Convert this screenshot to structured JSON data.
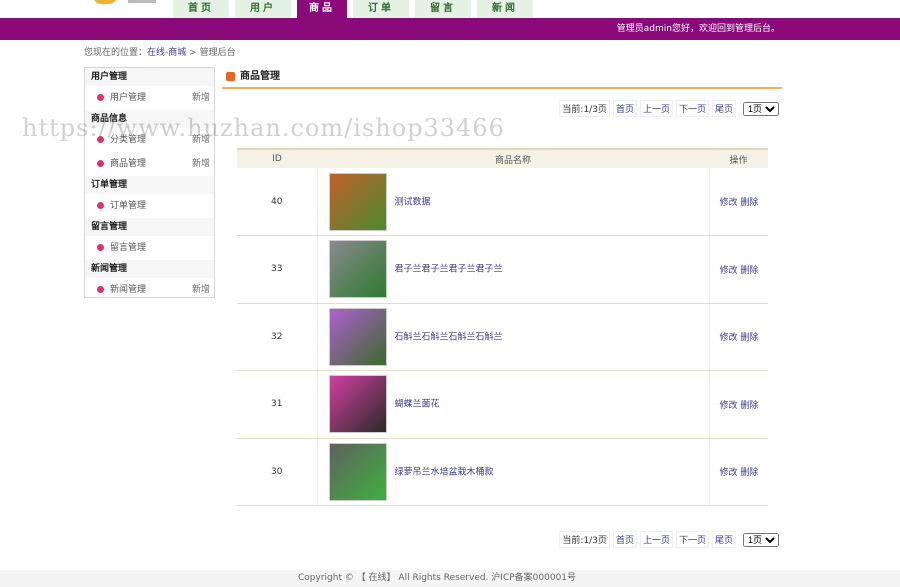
{
  "nav": {
    "tabs": [
      "首页",
      "用户",
      "商品",
      "订单",
      "留言",
      "新闻"
    ],
    "active": 2
  },
  "header": {
    "welcome": "管理员admin您好，欢迎回到管理后台。"
  },
  "breadcrumb": {
    "prefix": "您现在的位置：",
    "home": "在线-商城",
    "sep": ">",
    "current": "管理后台"
  },
  "sidebar": {
    "groups": [
      {
        "title": "用户管理",
        "items": [
          {
            "label": "用户管理",
            "add": "新增"
          }
        ]
      },
      {
        "title": "商品信息",
        "items": [
          {
            "label": "分类管理",
            "add": "新增"
          },
          {
            "label": "商品管理",
            "add": "新增"
          }
        ]
      },
      {
        "title": "订单管理",
        "items": [
          {
            "label": "订单管理"
          }
        ]
      },
      {
        "title": "留言管理",
        "items": [
          {
            "label": "留言管理"
          }
        ]
      },
      {
        "title": "新闻管理",
        "items": [
          {
            "label": "新闻管理",
            "add": "新增"
          }
        ]
      }
    ]
  },
  "main": {
    "title": "商品管理"
  },
  "pager": {
    "current": "当前:1/3页",
    "first": "首页",
    "prev": "上一页",
    "next": "下一页",
    "last": "尾页",
    "select": "1页"
  },
  "table": {
    "headers": [
      "ID",
      "商品名称",
      "操作"
    ],
    "rows": [
      {
        "id": "40",
        "name": "测试数据",
        "edit": "修改",
        "del": "删除",
        "img": [
          "#c0602a",
          "#4a8a30"
        ]
      },
      {
        "id": "33",
        "name": "君子兰君子兰君子兰君子兰",
        "edit": "修改",
        "del": "删除",
        "img": [
          "#8a8a90",
          "#2e7a2e"
        ]
      },
      {
        "id": "32",
        "name": "石斛兰石斛兰石斛兰石斛兰",
        "edit": "修改",
        "del": "删除",
        "img": [
          "#b060d0",
          "#3a6a2a"
        ]
      },
      {
        "id": "31",
        "name": "蝴蝶兰菌花",
        "edit": "修改",
        "del": "删除",
        "img": [
          "#d040a0",
          "#2a2a2a"
        ]
      },
      {
        "id": "30",
        "name": "绿萝吊兰水培盆栽木桶款",
        "edit": "修改",
        "del": "删除",
        "img": [
          "#606060",
          "#40b040"
        ]
      }
    ]
  },
  "footer": {
    "text": "Copyright © 【 在线】 All Rights Reserved. 沪ICP备案000001号"
  },
  "watermark": "https://www.huzhan.com/ishop33466",
  "colors": {
    "brand": "#8b0a7a",
    "accent": "#f0b060"
  }
}
